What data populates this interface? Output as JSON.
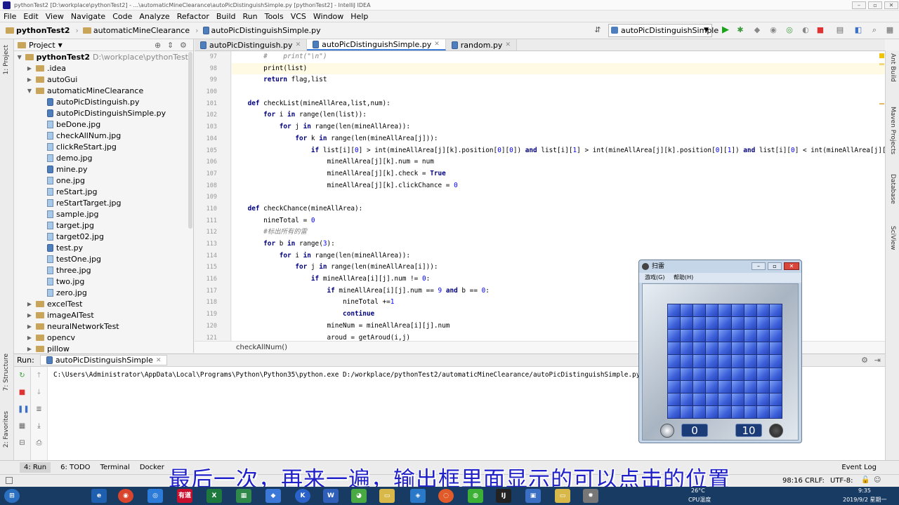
{
  "window": {
    "title": "pythonTest2 [D:\\workplace\\pythonTest2] - ...\\automaticMineClearance\\autoPicDistinguishSimple.py [pythonTest2] - IntelliJ IDEA",
    "menu": [
      "File",
      "Edit",
      "View",
      "Navigate",
      "Code",
      "Analyze",
      "Refactor",
      "Build",
      "Run",
      "Tools",
      "VCS",
      "Window",
      "Help"
    ],
    "breadcrumb": [
      "pythonTest2",
      "automaticMineClearance",
      "autoPicDistinguishSimple.py"
    ],
    "run_config": "autoPicDistinguishSimple"
  },
  "project": {
    "header": "Project",
    "root_name": "pythonTest2",
    "root_path": "D:\\workplace\\pythonTest2",
    "tree": [
      {
        "label": ".idea",
        "type": "folder",
        "level": 1,
        "arrow": "▶"
      },
      {
        "label": "autoGui",
        "type": "folder",
        "level": 1,
        "arrow": "▶"
      },
      {
        "label": "automaticMineClearance",
        "type": "folder",
        "level": 1,
        "arrow": "▼"
      },
      {
        "label": "autoPicDistinguish.py",
        "type": "py",
        "level": 2,
        "arrow": ""
      },
      {
        "label": "autoPicDistinguishSimple.py",
        "type": "py",
        "level": 2,
        "arrow": ""
      },
      {
        "label": "beDone.jpg",
        "type": "img",
        "level": 2,
        "arrow": ""
      },
      {
        "label": "checkAllNum.jpg",
        "type": "img",
        "level": 2,
        "arrow": ""
      },
      {
        "label": "clickReStart.jpg",
        "type": "img",
        "level": 2,
        "arrow": ""
      },
      {
        "label": "demo.jpg",
        "type": "img",
        "level": 2,
        "arrow": ""
      },
      {
        "label": "mine.py",
        "type": "py",
        "level": 2,
        "arrow": ""
      },
      {
        "label": "one.jpg",
        "type": "img",
        "level": 2,
        "arrow": ""
      },
      {
        "label": "reStart.jpg",
        "type": "img",
        "level": 2,
        "arrow": ""
      },
      {
        "label": "reStartTarget.jpg",
        "type": "img",
        "level": 2,
        "arrow": ""
      },
      {
        "label": "sample.jpg",
        "type": "img",
        "level": 2,
        "arrow": ""
      },
      {
        "label": "target.jpg",
        "type": "img",
        "level": 2,
        "arrow": ""
      },
      {
        "label": "target02.jpg",
        "type": "img",
        "level": 2,
        "arrow": ""
      },
      {
        "label": "test.py",
        "type": "py",
        "level": 2,
        "arrow": ""
      },
      {
        "label": "testOne.jpg",
        "type": "img",
        "level": 2,
        "arrow": ""
      },
      {
        "label": "three.jpg",
        "type": "img",
        "level": 2,
        "arrow": ""
      },
      {
        "label": "two.jpg",
        "type": "img",
        "level": 2,
        "arrow": ""
      },
      {
        "label": "zero.jpg",
        "type": "img",
        "level": 2,
        "arrow": ""
      },
      {
        "label": "excelTest",
        "type": "folder",
        "level": 1,
        "arrow": "▶"
      },
      {
        "label": "imageAITest",
        "type": "folder",
        "level": 1,
        "arrow": "▶"
      },
      {
        "label": "neuralNetworkTest",
        "type": "folder",
        "level": 1,
        "arrow": "▶"
      },
      {
        "label": "opencv",
        "type": "folder",
        "level": 1,
        "arrow": "▶"
      },
      {
        "label": "pillow",
        "type": "folder",
        "level": 1,
        "arrow": "▶"
      }
    ]
  },
  "editor": {
    "tabs": [
      "autoPicDistinguish.py",
      "autoPicDistinguishSimple.py",
      "random.py"
    ],
    "active_tab": 1,
    "line_numbers": [
      "97",
      "98",
      "99",
      "100",
      "101",
      "102",
      "103",
      "104",
      "105",
      "106",
      "107",
      "108",
      "109",
      "110",
      "111",
      "112",
      "113",
      "114",
      "115",
      "116",
      "117",
      "118",
      "119",
      "120",
      "121"
    ],
    "lines": [
      [
        [
          "cm",
          "        #    print(\"\\n\")"
        ]
      ],
      [
        [
          "",
          "        print(list)"
        ]
      ],
      [
        [
          "",
          "        "
        ],
        [
          "kw",
          "return"
        ],
        [
          "",
          " flag,list"
        ]
      ],
      [
        [
          "",
          ""
        ]
      ],
      [
        [
          "kw",
          "    def"
        ],
        [
          "",
          " checkList(mineAllArea,list,num):"
        ]
      ],
      [
        [
          "",
          "        "
        ],
        [
          "kw",
          "for"
        ],
        [
          "",
          " i "
        ],
        [
          "kw",
          "in"
        ],
        [
          "",
          " range(len(list)):"
        ]
      ],
      [
        [
          "",
          "            "
        ],
        [
          "kw",
          "for"
        ],
        [
          "",
          " j "
        ],
        [
          "kw",
          "in"
        ],
        [
          "",
          " range(len(mineAllArea)):"
        ]
      ],
      [
        [
          "",
          "                "
        ],
        [
          "kw",
          "for"
        ],
        [
          "",
          " k "
        ],
        [
          "kw",
          "in"
        ],
        [
          "",
          " range(len(mineAllArea[j])):"
        ]
      ],
      [
        [
          "",
          "                    "
        ],
        [
          "kw",
          "if"
        ],
        [
          "",
          " list[i]["
        ],
        [
          "num",
          "0"
        ],
        [
          "",
          "] > int(mineAllArea[j][k].position["
        ],
        [
          "num",
          "0"
        ],
        [
          "",
          "]["
        ],
        [
          "num",
          "0"
        ],
        [
          "",
          "]) "
        ],
        [
          "kw",
          "and"
        ],
        [
          "",
          " list[i]["
        ],
        [
          "num",
          "1"
        ],
        [
          "",
          "] > int(mineAllArea[j][k].position["
        ],
        [
          "num",
          "0"
        ],
        [
          "",
          "]["
        ],
        [
          "num",
          "1"
        ],
        [
          "",
          "]) "
        ],
        [
          "kw",
          "and"
        ],
        [
          "",
          " list[i]["
        ],
        [
          "num",
          "0"
        ],
        [
          "",
          "] < int(mineAllArea[j][k].position"
        ]
      ],
      [
        [
          "",
          "                        mineAllArea[j][k].num = num"
        ]
      ],
      [
        [
          "",
          "                        mineAllArea[j][k].check = "
        ],
        [
          "bool",
          "True"
        ]
      ],
      [
        [
          "",
          "                        mineAllArea[j][k].clickChance = "
        ],
        [
          "num",
          "0"
        ]
      ],
      [
        [
          "",
          ""
        ]
      ],
      [
        [
          "kw",
          "    def"
        ],
        [
          "",
          " checkChance(mineAllArea):"
        ]
      ],
      [
        [
          "",
          "        nineTotal = "
        ],
        [
          "num",
          "0"
        ]
      ],
      [
        [
          "cm",
          "        #标出所有的雷"
        ]
      ],
      [
        [
          "",
          "        "
        ],
        [
          "kw",
          "for"
        ],
        [
          "",
          " b "
        ],
        [
          "kw",
          "in"
        ],
        [
          "",
          " range("
        ],
        [
          "num",
          "3"
        ],
        [
          "",
          "):"
        ]
      ],
      [
        [
          "",
          "            "
        ],
        [
          "kw",
          "for"
        ],
        [
          "",
          " i "
        ],
        [
          "kw",
          "in"
        ],
        [
          "",
          " range(len(mineAllArea)):"
        ]
      ],
      [
        [
          "",
          "                "
        ],
        [
          "kw",
          "for"
        ],
        [
          "",
          " j "
        ],
        [
          "kw",
          "in"
        ],
        [
          "",
          " range(len(mineAllArea[i])):"
        ]
      ],
      [
        [
          "",
          "                    "
        ],
        [
          "kw",
          "if"
        ],
        [
          "",
          " mineAllArea[i][j].num != "
        ],
        [
          "num",
          "0"
        ],
        [
          "",
          ":"
        ]
      ],
      [
        [
          "",
          "                        "
        ],
        [
          "kw",
          "if"
        ],
        [
          "",
          " mineAllArea[i][j].num == "
        ],
        [
          "num",
          "9"
        ],
        [
          "",
          ""
        ],
        [
          "kw",
          " and"
        ],
        [
          "",
          " b == "
        ],
        [
          "num",
          "0"
        ],
        [
          "",
          ":"
        ]
      ],
      [
        [
          "",
          "                            nineTotal +="
        ],
        [
          "num",
          "1"
        ]
      ],
      [
        [
          "",
          "                            "
        ],
        [
          "kw",
          "continue"
        ]
      ],
      [
        [
          "",
          "                        mineNum = mineAllArea[i][j].num"
        ]
      ],
      [
        [
          "",
          "                        aroud = getAroud(i,j)"
        ]
      ]
    ],
    "crumb": "checkAllNum()"
  },
  "run": {
    "label": "Run:",
    "tab": "autoPicDistinguishSimple",
    "output": "C:\\Users\\Administrator\\AppData\\Local\\Programs\\Python\\Python35\\python.exe D:/workplace/pythonTest2/automaticMineClearance/autoPicDistinguishSimple.py"
  },
  "toolwindows": {
    "run": "4: Run",
    "todo": "6: TODO",
    "terminal": "Terminal",
    "docker": "Docker",
    "event_log": "Event Log"
  },
  "status": {
    "position": "98:16",
    "line_sep": "CRLF:",
    "encoding": "UTF-8:"
  },
  "side": {
    "left": [
      "1: Project",
      "7: Structure",
      "2: Favorites"
    ],
    "right": [
      "Ant Build",
      "Maven Projects",
      "Database",
      "SciView"
    ]
  },
  "minesweeper": {
    "title": "扫雷",
    "menu": [
      "游戏(G)",
      "帮助(H)"
    ],
    "time": "0",
    "mines": "10",
    "rows": 9,
    "cols": 9
  },
  "subtitle": "最后一次，再来一遍，输出框里面显示的可以点击的位置",
  "taskbar": {
    "temp": "26°C",
    "cpu": "CPU温度",
    "time": "9:35",
    "date": "2019/9/2 星期一"
  }
}
